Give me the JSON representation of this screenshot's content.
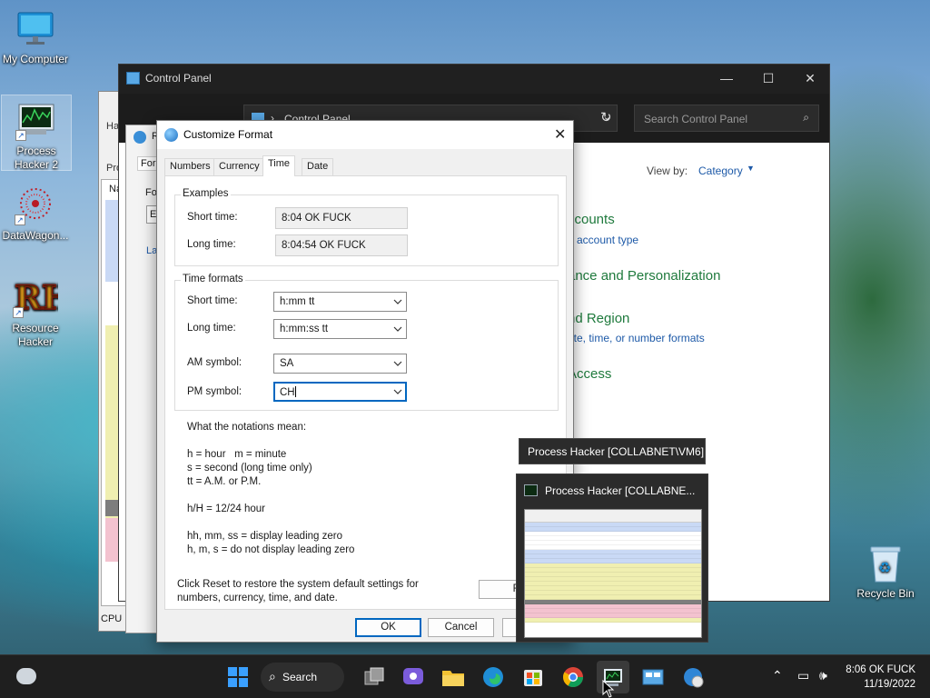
{
  "desktop": {
    "icons": [
      {
        "label": "My Computer"
      },
      {
        "label": "Process Hacker 2"
      },
      {
        "label": "DataWagon..."
      },
      {
        "label": "Resource Hacker"
      },
      {
        "label": "Recycle Bin"
      }
    ]
  },
  "process_hacker_window": {
    "fragments": [
      "Ha",
      "Pro",
      "Na",
      "CPU Usage:"
    ]
  },
  "region_window": {
    "fragments": [
      "R",
      "Form",
      "Fo",
      "E",
      "La"
    ]
  },
  "control_panel": {
    "title": "Control Panel",
    "address": "Control Panel",
    "search_placeholder": "Search Control Panel",
    "view_by_label": "View by:",
    "view_by_value": "Category",
    "sections": [
      {
        "heading": "ccounts",
        "link": "e account type"
      },
      {
        "heading": "ance and Personalization",
        "link": ""
      },
      {
        "heading": "nd Region",
        "link": "ate, time, or number formats"
      },
      {
        "heading": "Access",
        "link": ""
      }
    ]
  },
  "customize_format": {
    "title": "Customize Format",
    "tabs": [
      "Numbers",
      "Currency",
      "Time",
      "Date"
    ],
    "active_tab": "Time",
    "examples": {
      "group_label": "Examples",
      "short_time_label": "Short time:",
      "short_time_value": "8:04 OK FUCK",
      "long_time_label": "Long time:",
      "long_time_value": "8:04:54 OK FUCK"
    },
    "time_formats": {
      "group_label": "Time formats",
      "short_time_label": "Short time:",
      "short_time_value": "h:mm tt",
      "long_time_label": "Long time:",
      "long_time_value": "h:mm:ss tt",
      "am_label": "AM symbol:",
      "am_value": "SA",
      "pm_label": "PM symbol:",
      "pm_value": "CH"
    },
    "notation": {
      "heading": "What the notations mean:",
      "line1": "h = hour   m = minute",
      "line2": "s = second (long time only)",
      "line3": "tt = A.M. or P.M.",
      "line4": "h/H = 12/24 hour",
      "line5": "hh, mm, ss = display leading zero",
      "line6": "h, m, s = do not display leading zero"
    },
    "reset_note_1": "Click Reset to restore the system default settings for",
    "reset_note_2": "numbers, currency, time, and date.",
    "reset_label": "Re",
    "ok_label": "OK",
    "cancel_label": "Cancel"
  },
  "taskbar_preview": {
    "tooltip": "Process Hacker [COLLABNET\\VM6]",
    "thumb_title": "Process Hacker [COLLABNE..."
  },
  "taskbar": {
    "search_label": "Search",
    "time": "8:06 OK FUCK",
    "date": "11/19/2022"
  },
  "colors": {
    "accent": "#0067c0",
    "cp_green": "#1f7a3d",
    "cp_link": "#1e5aa8",
    "taskbar": "#1f1f1f"
  }
}
